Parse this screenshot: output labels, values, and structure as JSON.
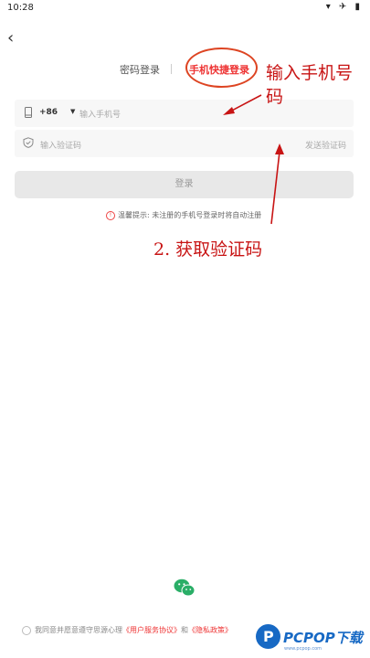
{
  "status_bar": {
    "time": "10:28",
    "icons": "▾ ✈ ▮"
  },
  "nav": {
    "back_glyph": "‹"
  },
  "tabs": {
    "password_login": "密码登录",
    "quick_login": "手机快捷登录"
  },
  "phone_field": {
    "country_code": "+86",
    "caret": "▼",
    "placeholder": "输入手机号"
  },
  "code_field": {
    "placeholder": "输入验证码",
    "send_label": "发送验证码"
  },
  "login_button": {
    "label": "登录"
  },
  "tip": {
    "icon": "!",
    "text": "温馨提示: 未注册的手机号登录时将自动注册"
  },
  "annotations": {
    "step1": "输入手机号码",
    "step2": "2. 获取验证码",
    "color": "#c81414"
  },
  "agreement": {
    "prefix": "我同意并愿意遵守思源心理",
    "terms": "《用户服务协议》",
    "and": "和",
    "privacy": "《隐私政策》"
  },
  "watermark": {
    "logo_letter": "P",
    "text": "PCPOP下载",
    "sub": "www.pcpop.com"
  },
  "colors": {
    "accent": "#ee3333",
    "annotation": "#c81414",
    "wechat": "#2aae67"
  }
}
